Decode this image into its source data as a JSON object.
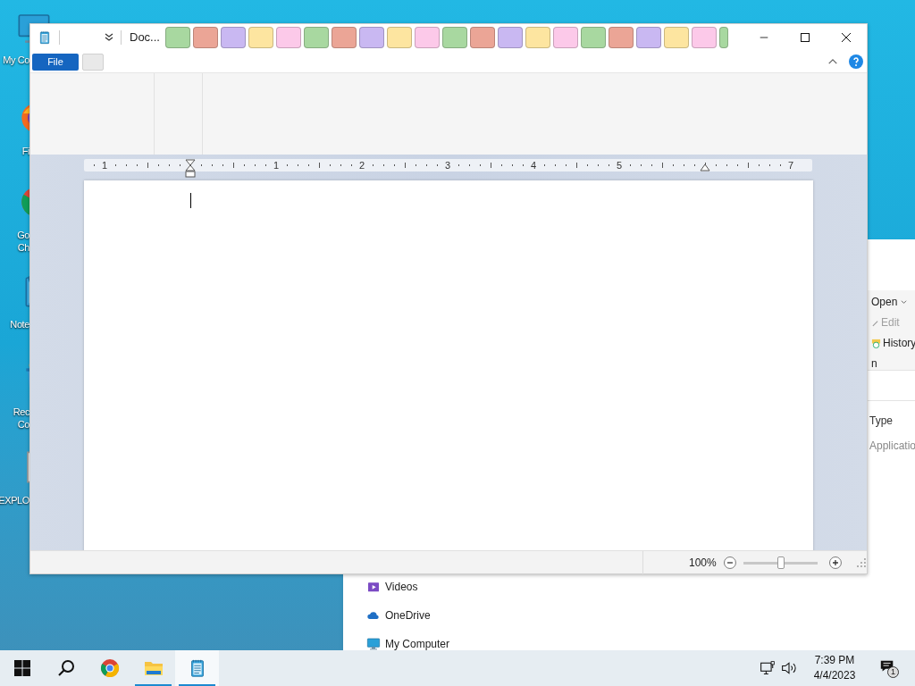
{
  "desktop_icons": [
    {
      "kind": "monitor",
      "lines": [
        "My Co"
      ]
    },
    {
      "kind": "firefox",
      "lines": [
        "Fi"
      ]
    },
    {
      "kind": "chrome",
      "lines": [
        "Go",
        "Ch"
      ]
    },
    {
      "kind": "notes",
      "lines": [
        "Note"
      ]
    },
    {
      "kind": "recycle",
      "lines": [
        "Rec",
        "Co"
      ]
    },
    {
      "kind": "file",
      "lines": [
        "EXPLO"
      ]
    }
  ],
  "background_window": {
    "ribbon": [
      {
        "kind": "open",
        "label": "Open",
        "disabled": false
      },
      {
        "kind": "edit",
        "label": "Edit",
        "disabled": true
      },
      {
        "kind": "history",
        "label": "History",
        "disabled": false
      },
      {
        "kind": "text",
        "label": "n",
        "disabled": false
      }
    ],
    "column_header": "Type",
    "row_type": "Applicatio",
    "nav": [
      {
        "kind": "videos",
        "label": "Videos"
      },
      {
        "kind": "cloud",
        "label": "OneDrive"
      },
      {
        "kind": "monitor",
        "label": "My Computer"
      }
    ]
  },
  "notepad": {
    "title": "Doc...",
    "file_button": "File",
    "swatches": [
      {
        "color": "#a8d8a0",
        "kind": "full"
      },
      {
        "color": "#eba596",
        "kind": "full"
      },
      {
        "color": "#c9b8f2",
        "kind": "full"
      },
      {
        "color": "#fde5a0",
        "kind": "full"
      },
      {
        "color": "#fcc9e9",
        "kind": "full"
      },
      {
        "color": "#a8d8a0",
        "kind": "full"
      },
      {
        "color": "#eba596",
        "kind": "full"
      },
      {
        "color": "#c9b8f2",
        "kind": "full"
      },
      {
        "color": "#fde5a0",
        "kind": "full"
      },
      {
        "color": "#fcc9e9",
        "kind": "full"
      },
      {
        "color": "#a8d8a0",
        "kind": "full"
      },
      {
        "color": "#eba596",
        "kind": "full"
      },
      {
        "color": "#c9b8f2",
        "kind": "full"
      },
      {
        "color": "#fde5a0",
        "kind": "full"
      },
      {
        "color": "#fcc9e9",
        "kind": "full"
      },
      {
        "color": "#a8d8a0",
        "kind": "full"
      },
      {
        "color": "#eba596",
        "kind": "full"
      },
      {
        "color": "#c9b8f2",
        "kind": "full"
      },
      {
        "color": "#fde5a0",
        "kind": "full"
      },
      {
        "color": "#fcc9e9",
        "kind": "full"
      },
      {
        "color": "#a8d8a0",
        "kind": "partial"
      }
    ],
    "ruler": [
      {
        "kind": "number",
        "text": "1"
      },
      {
        "kind": "indent"
      },
      {
        "kind": "number",
        "text": "1"
      },
      {
        "kind": "number",
        "text": "2"
      },
      {
        "kind": "number",
        "text": "3"
      },
      {
        "kind": "number",
        "text": "4"
      },
      {
        "kind": "number",
        "text": "5"
      },
      {
        "kind": "margin"
      },
      {
        "kind": "number",
        "text": "7"
      }
    ],
    "zoom": {
      "reading": "100%",
      "level": 0.5
    }
  },
  "taskbar": {
    "apps": [
      {
        "kind": "start",
        "running": false,
        "selected": false
      },
      {
        "kind": "search",
        "running": false,
        "selected": false
      },
      {
        "kind": "chrome",
        "running": false,
        "selected": false
      },
      {
        "kind": "folder",
        "running": true,
        "selected": false
      },
      {
        "kind": "notes",
        "running": true,
        "selected": true
      }
    ],
    "time": "7:39 PM",
    "date": "4/4/2023",
    "notifications": "1"
  }
}
